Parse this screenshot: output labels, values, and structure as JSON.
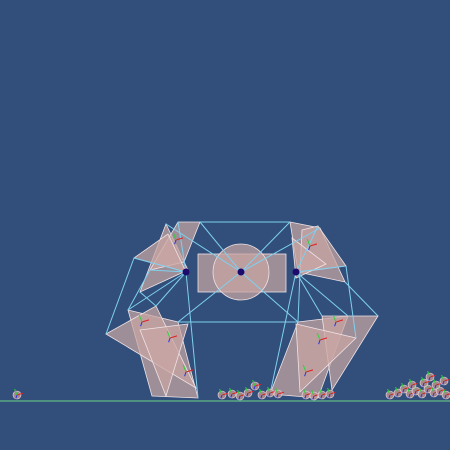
{
  "scene": {
    "background_color": "#314f7a",
    "ground_color": "#6fd68a",
    "body_fill": "#c9a6a3",
    "body_stroke": "#efe3e6",
    "link_color": "#7fd0ee",
    "joint_color": "#1d0a6e",
    "debris_fill": "#b98f93",
    "axis_red": "#e01f1f",
    "axis_green": "#2bd23a",
    "axis_blue": "#2a34d8"
  }
}
